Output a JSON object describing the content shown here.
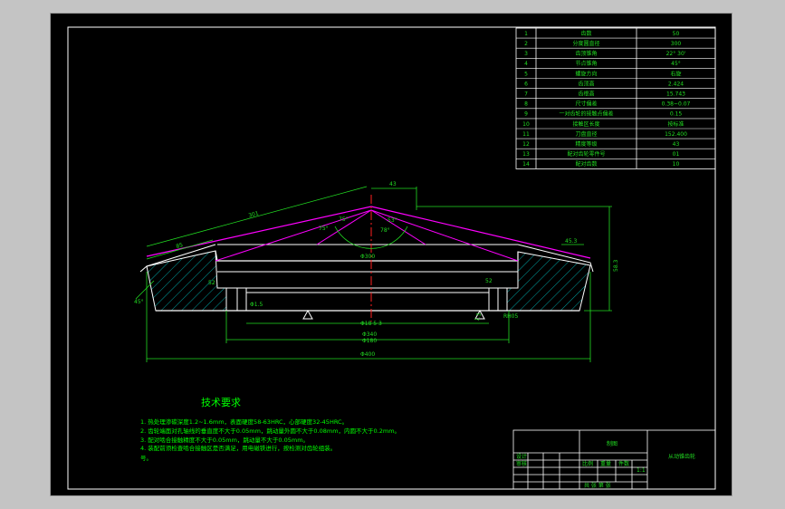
{
  "colors": {
    "sheet_bg": "#000000",
    "outer_bg": "#c4c4c4",
    "line": "#ffffff",
    "dimension": "#22dd22",
    "construction": "#ff00ff",
    "centerline": "#ff2020",
    "hatch": "#00a0a0",
    "notes": "#00ff00"
  },
  "param_table": {
    "rows": [
      {
        "no": "1",
        "name": "齿数",
        "value": "50"
      },
      {
        "no": "2",
        "name": "分度圆直径",
        "value": "300"
      },
      {
        "no": "3",
        "name": "齿顶锥角",
        "value": "22° 30'"
      },
      {
        "no": "4",
        "name": "节点锥角",
        "value": "45°"
      },
      {
        "no": "5",
        "name": "螺旋方向",
        "value": "右旋"
      },
      {
        "no": "6",
        "name": "齿顶高",
        "value": "2.424"
      },
      {
        "no": "7",
        "name": "齿根高",
        "value": "15.743"
      },
      {
        "no": "8",
        "name": "尺寸偏差",
        "value": "0.38~0.07"
      },
      {
        "no": "9",
        "name": "一对齿轮的接触点偏差",
        "value": "0.15"
      },
      {
        "no": "10",
        "name": "接触区长度",
        "value": "按标准"
      },
      {
        "no": "11",
        "name": "刀盘直径",
        "value": "152.400"
      },
      {
        "no": "12",
        "name": "精度等级",
        "value": "43"
      },
      {
        "no": "13",
        "name": "配对齿轮零件号",
        "value": "01"
      },
      {
        "no": "14",
        "name": "配对齿数",
        "value": "10"
      }
    ]
  },
  "dimensions": {
    "d_top": "43",
    "slant_outer": "301",
    "slant_inner": "85",
    "angle_a": "75°",
    "angle_b": "75°",
    "angle_c": "78°",
    "angle_d": "53°",
    "inner_dia": "Φ300",
    "right_h": "58.3",
    "right_small": "45.3",
    "left_angle": "45°",
    "bore_a": "52",
    "bore_b": "52",
    "bore_chamfer": "Φ1.5",
    "bottom_left": "Φ18 5 3",
    "dia_inner": "Φ180",
    "dia_mid": "Φ340",
    "dia_outer": "Φ400",
    "seat_tag": "1.5",
    "side_tag": "RH05"
  },
  "notes": {
    "title": "技术要求",
    "items": [
      "1. 热处理渗碳深度1.2~1.6mm，表面硬度58-63HRC，心部硬度32-45HRC。",
      "2. 齿轮端面对孔轴线的垂直度不大于0.05mm，跳动量外圆不大于0.08mm，内圆不大于0.2mm。",
      "3. 配对啮合接触精度不大于0.05mm，跳动量不大于0.05mm。",
      "4. 装配前须检查啮合接触区是否满足，用电磁铁进行，按检测对齿轮组装。",
      "号。"
    ]
  },
  "title_block": {
    "part_name": "从动锥齿轮",
    "label_drawing": "制图",
    "label_design": "设计",
    "label_check": "审核",
    "label_ratio": "比例",
    "label_weight": "重量",
    "label_qty": "件数",
    "ratio_val": "1:1",
    "sheet": "共 张 第 张"
  }
}
